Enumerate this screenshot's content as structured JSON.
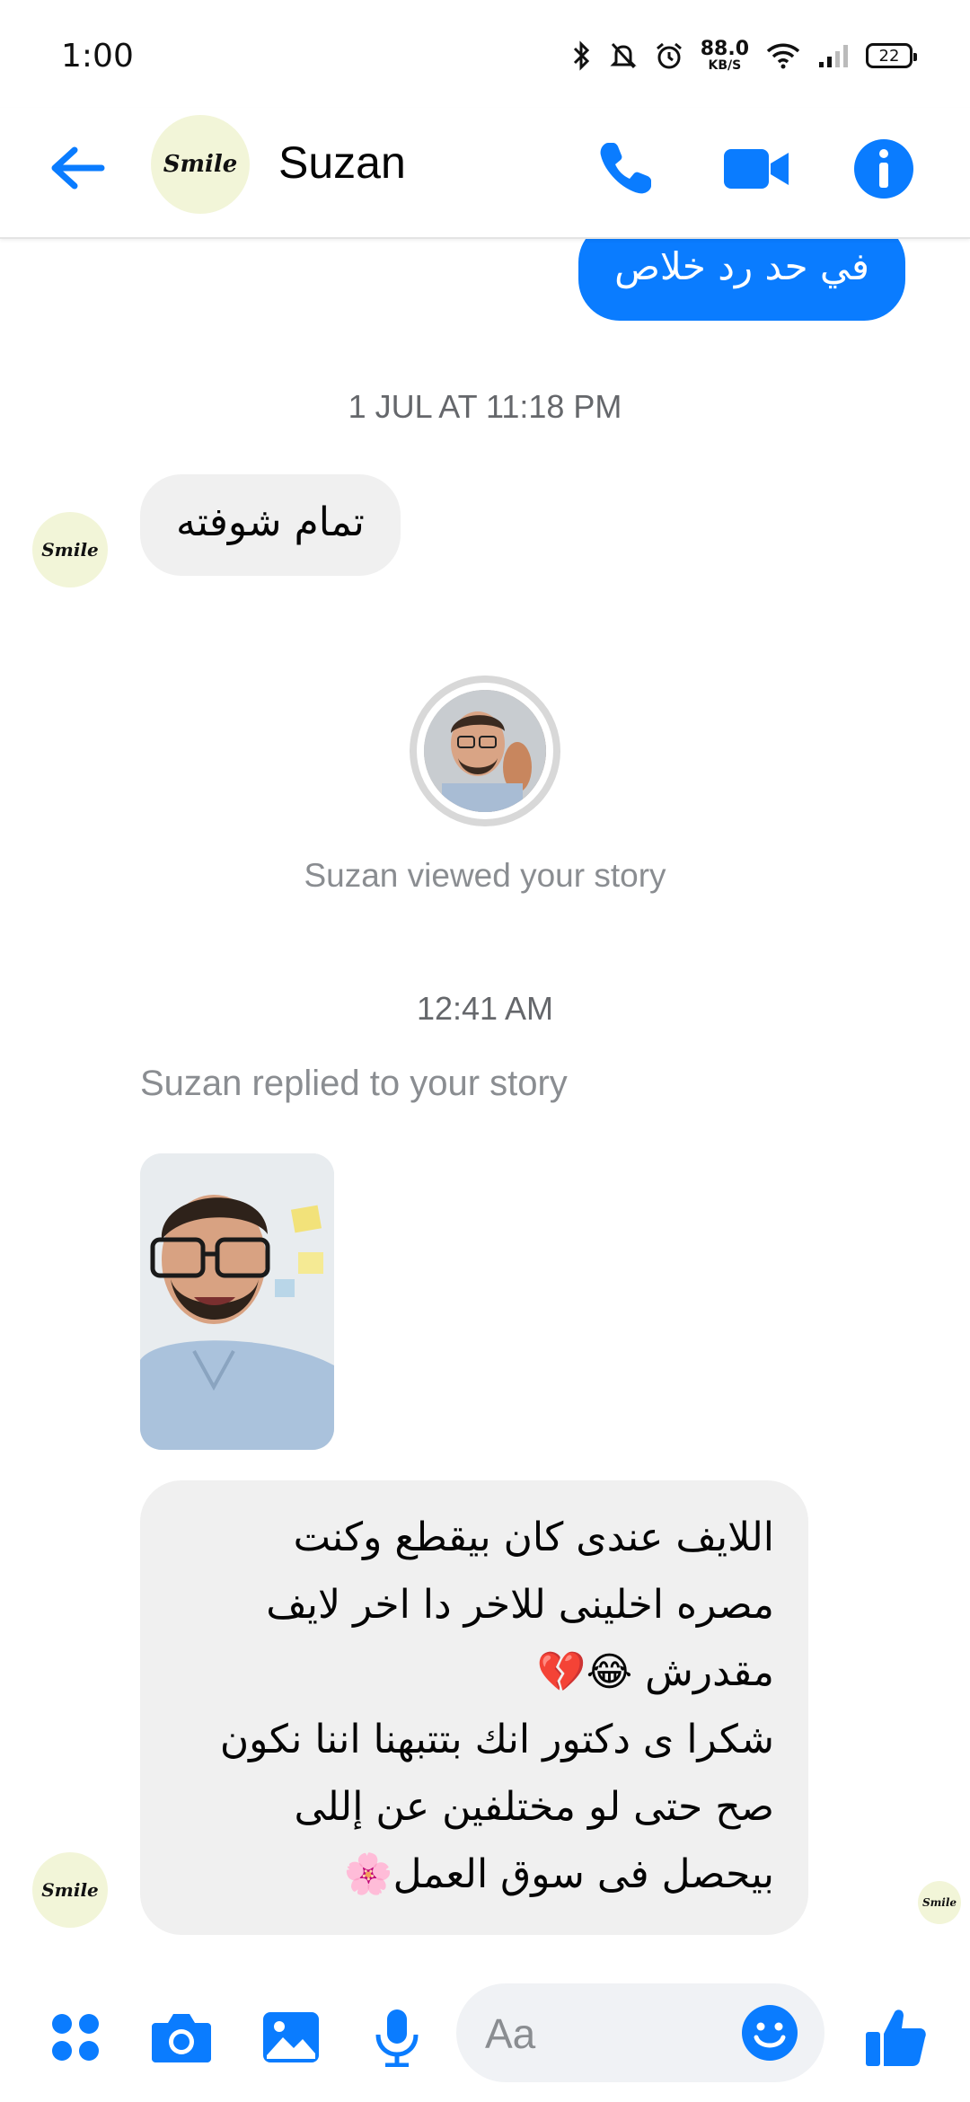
{
  "status_bar": {
    "time": "1:00",
    "net_speed_value": "88.0",
    "net_speed_unit": "KB/S",
    "battery": "22"
  },
  "header": {
    "contact_name": "Suzan",
    "avatar_logo_text": "Smile"
  },
  "colors": {
    "accent": "#0a7cff",
    "incoming_bubble": "#f0f0f0",
    "muted_text": "#8a8d91"
  },
  "messages": {
    "outgoing_top": "في حد رد خلاص",
    "timestamp_1": "1 JUL AT 11:18 PM",
    "incoming_1": "تمام شوفته",
    "story_viewed_caption": "Suzan viewed your story",
    "timestamp_2": "12:41 AM",
    "replied_label": "Suzan replied to your story",
    "incoming_2_lines": [
      "اللايف عندى كان بيقطع وكنت",
      "مصره اخلينى للاخر دا اخر لايف",
      "مقدرش 😂💔",
      "شكرا ى دكتور انك بتتبهنا اننا نكون",
      "صح حتى لو مختلفين عن إللى",
      "بيحصل فى سوق العمل🌸"
    ]
  },
  "composer": {
    "placeholder": "Aa"
  },
  "icons": {
    "back": "arrow-left-icon",
    "call": "phone-icon",
    "video": "video-camera-icon",
    "info": "info-icon",
    "apps": "apps-grid-icon",
    "camera": "camera-icon",
    "gallery": "image-icon",
    "mic": "microphone-icon",
    "emoji": "emoji-icon",
    "like": "thumbs-up-icon"
  }
}
